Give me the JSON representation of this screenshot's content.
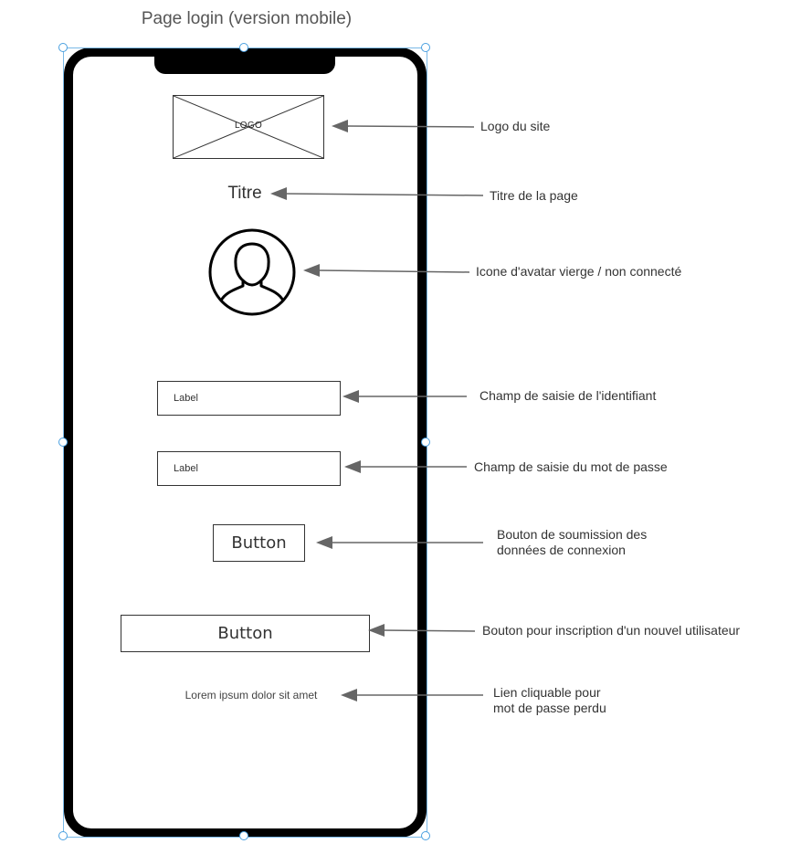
{
  "title": "Page login (version mobile)",
  "screen": {
    "logo_text": "LOGO",
    "heading": "Titre",
    "login_field_label": "Label",
    "password_field_label": "Label",
    "submit_button": "Button",
    "register_button": "Button",
    "forgot_link": "Lorem ipsum dolor sit amet"
  },
  "annotations": {
    "logo": "Logo du site",
    "heading": "Titre de la page",
    "avatar": "Icone d'avatar vierge / non connecté",
    "login_field": "Champ de saisie de l'identifiant",
    "password_field": "Champ de saisie du mot de passe",
    "submit_line1": "Bouton de soumission des",
    "submit_line2": "données de connexion",
    "register": "Bouton pour inscription d'un nouvel utilisateur",
    "forgot_line1": "Lien cliquable pour",
    "forgot_line2": "mot de passe perdu"
  },
  "colors": {
    "frame": "#000000",
    "arrow": "#666666",
    "selection": "#4aa0e0"
  }
}
